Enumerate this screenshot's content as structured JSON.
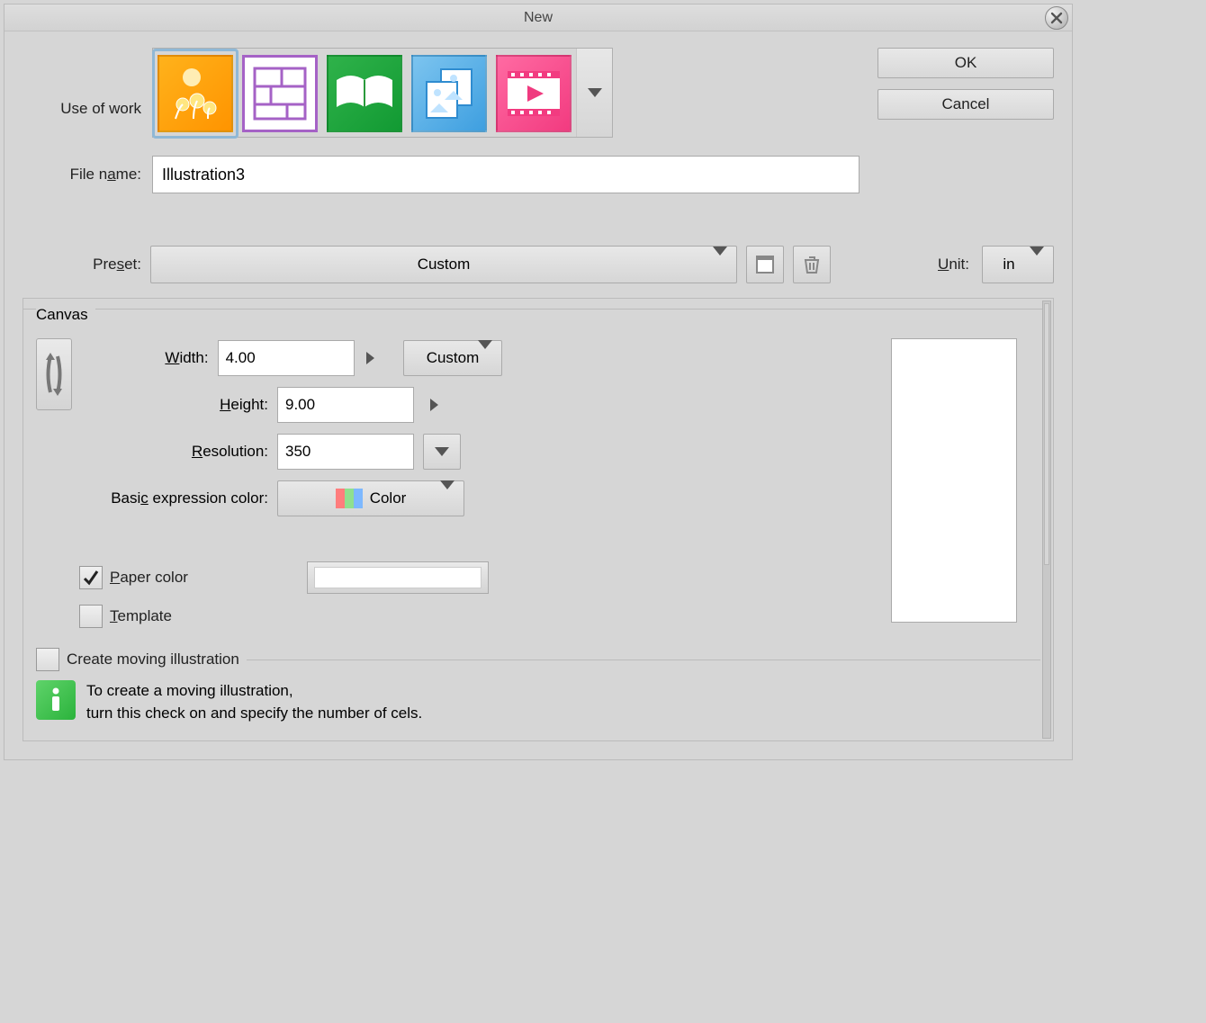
{
  "title": "New",
  "labels": {
    "use_of_work": "Use of work",
    "file_name_pre": "File n",
    "file_name_u": "a",
    "file_name_post": "me:",
    "preset_pre": "Pre",
    "preset_u": "s",
    "preset_post": "et:",
    "unit_u": "U",
    "unit_post": "nit:",
    "canvas": "Canvas",
    "width_u": "W",
    "width_post": "idth:",
    "height_u": "H",
    "height_post": "eight:",
    "resolution_u": "R",
    "resolution_post": "esolution:",
    "basic_color_pre": "Basi",
    "basic_color_u": "c",
    "basic_color_post": " expression color:",
    "paper_u": "P",
    "paper_post": "aper color",
    "template_u": "T",
    "template_post": "emplate",
    "moving": "Create moving illustration",
    "info1": "To create a moving illustration,",
    "info2": "turn this check on and specify the number of cels."
  },
  "buttons": {
    "ok": "OK",
    "cancel": "Cancel"
  },
  "file_name": "Illustration3",
  "preset": "Custom",
  "unit": "in",
  "canvas": {
    "width": "4.00",
    "height": "9.00",
    "resolution": "350",
    "size_preset": "Custom",
    "basic_color": "Color"
  },
  "checks": {
    "paper_color": true,
    "template": false,
    "moving": false
  },
  "work_tiles": [
    {
      "name": "work-illustration",
      "selected": true
    },
    {
      "name": "work-comic",
      "selected": false
    },
    {
      "name": "work-book",
      "selected": false
    },
    {
      "name": "work-printing",
      "selected": false
    },
    {
      "name": "work-animation",
      "selected": false
    }
  ]
}
